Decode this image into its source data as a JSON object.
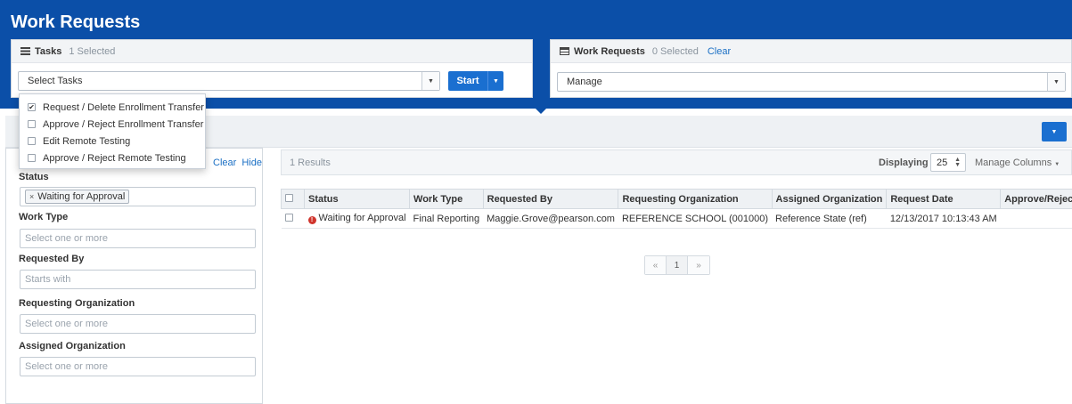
{
  "header": {
    "title": "Work Requests"
  },
  "tasks_panel": {
    "title": "Tasks",
    "count": "1 Selected",
    "select_value": "Select Tasks",
    "start_label": "Start",
    "options": [
      {
        "label": "Request / Delete Enrollment Transfer",
        "checked": true
      },
      {
        "label": "Approve / Reject Enrollment Transfer",
        "checked": false
      },
      {
        "label": "Edit Remote Testing",
        "checked": false
      },
      {
        "label": "Approve / Reject Remote Testing",
        "checked": false
      }
    ]
  },
  "work_requests_panel": {
    "title": "Work Requests",
    "count": "0 Selected",
    "clear_label": "Clear",
    "select_value": "Manage"
  },
  "filters": {
    "clear_label": "Clear",
    "hide_label": "Hide",
    "status": {
      "label": "Status",
      "tag": "Waiting for Approval"
    },
    "work_type": {
      "label": "Work Type",
      "placeholder": "Select one or more"
    },
    "requested_by": {
      "label": "Requested By",
      "placeholder": "Starts with"
    },
    "requesting_org": {
      "label": "Requesting Organization",
      "placeholder": "Select one or more"
    },
    "assigned_org": {
      "label": "Assigned Organization",
      "placeholder": "Select one or more"
    }
  },
  "results": {
    "count_text": "1 Results",
    "displaying_label": "Displaying",
    "page_size": "25",
    "manage_columns_label": "Manage Columns"
  },
  "table": {
    "columns": [
      "Status",
      "Work Type",
      "Requested By",
      "Requesting Organization",
      "Assigned Organization",
      "Request Date",
      "Approve/Reject Date"
    ],
    "rows": [
      {
        "status": "Waiting for Approval",
        "work_type": "Final Reporting",
        "requested_by": "Maggie.Grove@pearson.com",
        "requesting_org": "REFERENCE SCHOOL (001000)",
        "assigned_org": "Reference State (ref)",
        "request_date": "12/13/2017 10:13:43 AM",
        "approve_reject_date": ""
      }
    ]
  },
  "pager": {
    "prev": "«",
    "current": "1",
    "next": "»"
  },
  "colors": {
    "brand_blue": "#0b4fa8",
    "button_blue": "#1a6fd0",
    "link_blue": "#1a6fc4",
    "warning_red": "#d0342c"
  },
  "icons": {
    "tasks": "list-icon",
    "work_requests": "table-icon",
    "status_warning": "exclamation-circle-icon",
    "dropdown": "caret-down-icon"
  }
}
